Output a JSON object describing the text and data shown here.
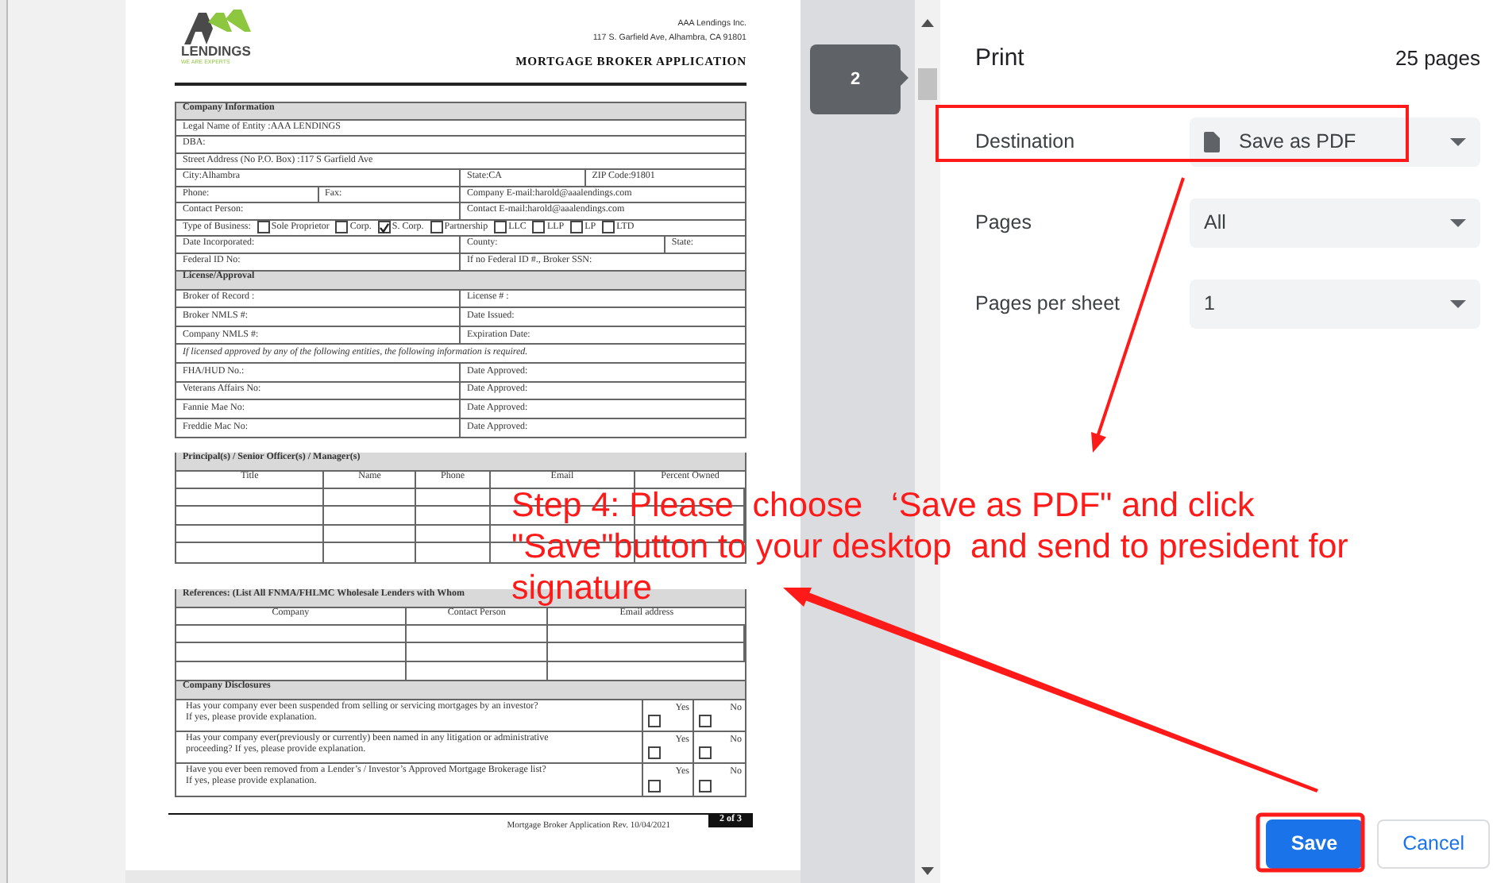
{
  "document": {
    "logo_text": "LENDINGS",
    "logo_tagline": "WE ARE EXPERTS",
    "company": "AAA Lendings Inc.",
    "address": "117 S. Garfield Ave, Alhambra, CA 91801",
    "title": "MORTGAGE BROKER APPLICATION",
    "sections": [
      {
        "kind": "form",
        "heading": "Company Information",
        "rows": [
          {
            "kind": "full",
            "cells": [
              "Legal Name of Entity :AAA LENDINGS"
            ]
          },
          {
            "kind": "full",
            "cells": [
              "DBA:"
            ]
          },
          {
            "kind": "full",
            "cells": [
              "Street Address (No P.O. Box) :117 S Garfield Ave"
            ]
          },
          {
            "kind": "city",
            "cells": [
              "City:Alhambra",
              "State:CA",
              "ZIP Code:91801"
            ]
          },
          {
            "kind": "phone",
            "cells": [
              "Phone:",
              "Fax:",
              "Company E-mail:harold@aaalendings.com"
            ]
          },
          {
            "kind": "half",
            "cells": [
              "Contact Person:",
              "Contact E-mail:harold@aaalendings.com"
            ]
          },
          {
            "kind": "business",
            "label": "Type of Business:",
            "options": [
              {
                "label": "Sole Proprietor",
                "checked": false
              },
              {
                "label": "Corp.",
                "checked": false
              },
              {
                "label": "S. Corp.",
                "checked": true
              },
              {
                "label": "Partnership",
                "checked": false
              },
              {
                "label": "LLC",
                "checked": false
              },
              {
                "label": "LLP",
                "checked": false
              },
              {
                "label": "LP",
                "checked": false
              },
              {
                "label": "LTD",
                "checked": false
              }
            ]
          },
          {
            "kind": "county",
            "cells": [
              "Date Incorporated:",
              "County:",
              "State:"
            ]
          },
          {
            "kind": "half",
            "cells": [
              "Federal ID No:",
              "If no Federal ID #., Broker SSN:"
            ]
          }
        ]
      },
      {
        "kind": "form",
        "heading": "License/Approval",
        "rows": [
          {
            "kind": "half",
            "cells": [
              "Broker of Record :",
              "License # :"
            ]
          },
          {
            "kind": "half",
            "cells": [
              "Broker NMLS #:",
              "Date Issued:"
            ]
          },
          {
            "kind": "half",
            "cells": [
              "Company NMLS #:",
              "Expiration Date:"
            ]
          },
          {
            "kind": "note",
            "cells": [
              "If licensed approved by any of the following entities, the following information is required."
            ]
          },
          {
            "kind": "half",
            "cells": [
              "FHA/HUD No.:",
              "Date Approved:"
            ]
          },
          {
            "kind": "half",
            "cells": [
              "Veterans Affairs No:",
              "Date Approved:"
            ]
          },
          {
            "kind": "half",
            "cells": [
              "Fannie Mae No:",
              "Date Approved:"
            ]
          },
          {
            "kind": "half",
            "cells": [
              "Freddie Mac No:",
              "Date Approved:"
            ]
          }
        ]
      },
      {
        "kind": "grid",
        "heading": "Principal(s) / Senior Officer(s) / Manager(s)",
        "columns": [
          "Title",
          "Name",
          "Phone",
          "Email",
          "Percent Owned"
        ]
      },
      {
        "kind": "grid",
        "heading": "References: (List All FNMA/FHLMC Wholesale Lenders with Whom",
        "columns": [
          "Company",
          "Contact Person",
          "Email address"
        ]
      },
      {
        "kind": "disclosures",
        "heading": "Company Disclosures",
        "questions": [
          {
            "text": "Has your company ever been suspended from selling or servicing mortgages by an investor?\nIf yes, please provide explanation.",
            "options": [
              {
                "label": "Yes",
                "checked": false
              },
              {
                "label": "No",
                "checked": false
              }
            ]
          },
          {
            "text": "Has your company ever(previously or currently) been named in any litigation or administrative\nproceeding? If yes, please provide explanation.",
            "options": [
              {
                "label": "Yes",
                "checked": false
              },
              {
                "label": "No",
                "checked": false
              }
            ]
          },
          {
            "text": "Have you ever been removed from a Lender’s / Investor’s Approved Mortgage Brokerage list?\nIf yes, please provide explanation.",
            "options": [
              {
                "label": "Yes",
                "checked": false
              },
              {
                "label": "No",
                "checked": false
              }
            ]
          }
        ]
      }
    ],
    "footer": "Mortgage Broker Application Rev. 10/04/2021",
    "page_label": "2 of 3"
  },
  "page_bubble": "2",
  "print": {
    "title": "Print",
    "page_count": "25 pages",
    "settings": [
      {
        "kind": "destination",
        "label": "Destination",
        "value": "Save as PDF"
      },
      {
        "kind": "plain",
        "label": "Pages",
        "value": "All"
      },
      {
        "kind": "plain",
        "label": "Pages per sheet",
        "value": "1"
      }
    ],
    "buttons": [
      {
        "kind": "primary",
        "label": "Save"
      },
      {
        "kind": "secondary",
        "label": "Cancel"
      }
    ]
  },
  "annotation": {
    "lines": [
      "Step 4: Please  choose   ‘Save as PDF\" and click",
      "\"Save\"button to your desktop  and send to president for",
      "signature"
    ]
  }
}
